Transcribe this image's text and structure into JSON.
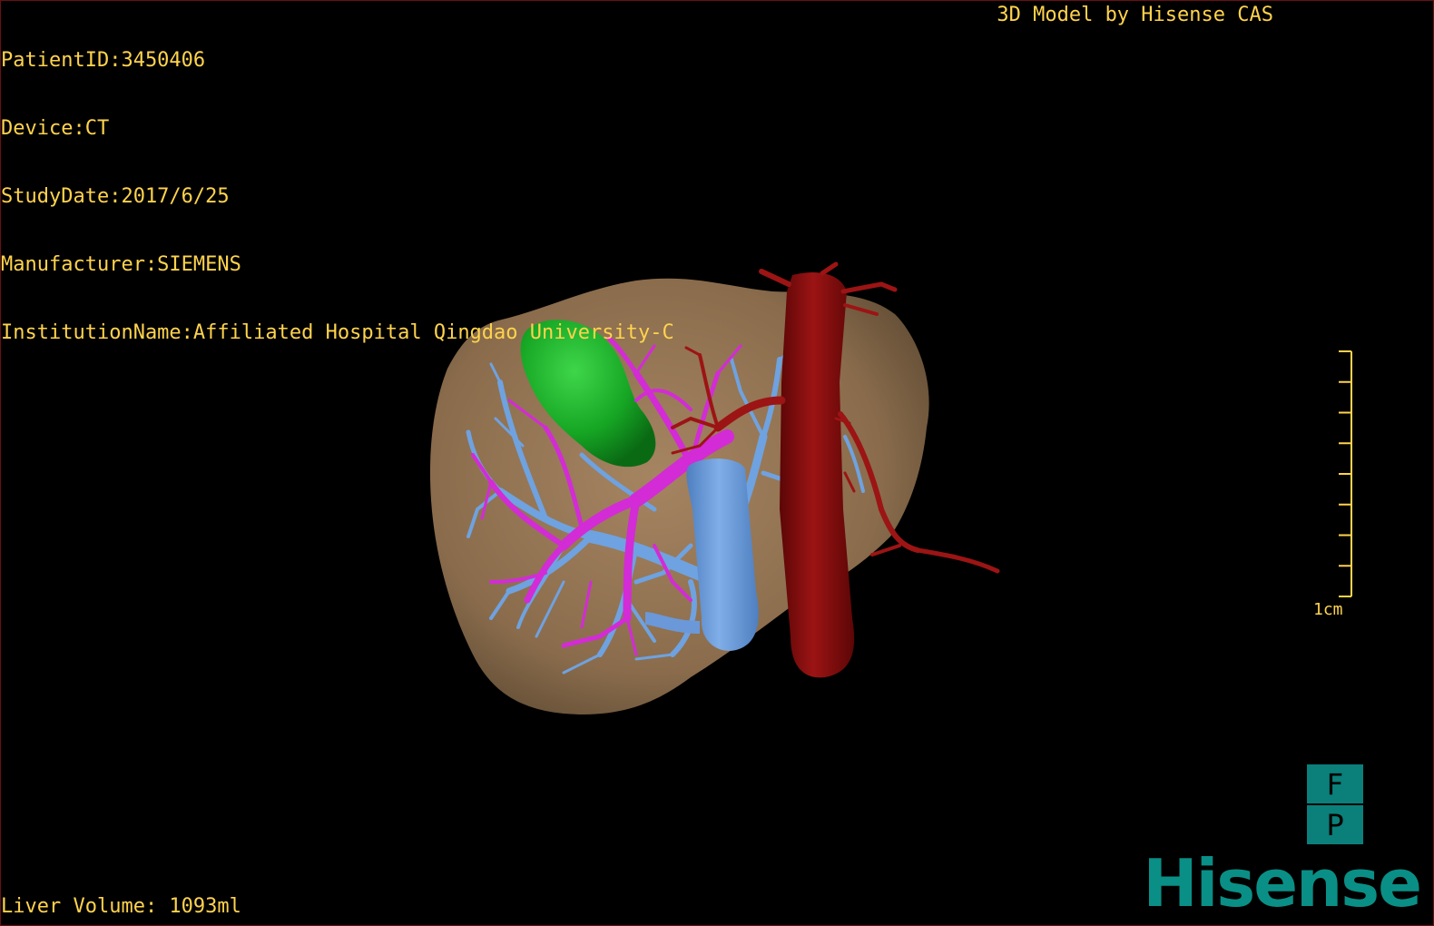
{
  "header": {
    "patient_id": "PatientID:3450406",
    "device": "Device:CT",
    "study_date": "StudyDate:2017/6/25",
    "manufacturer": "Manufacturer:SIEMENS",
    "institution": "InstitutionName:Affiliated Hospital Qingdao University-C"
  },
  "credit": "3D Model by Hisense CAS",
  "footer": {
    "liver_volume": "Liver Volume: 1093ml"
  },
  "scale": {
    "label": "1cm",
    "ticks": 9
  },
  "orientation": {
    "top": "F",
    "bottom": "P"
  },
  "brand": {
    "name": "Hisense",
    "color": "#0a8f86"
  },
  "colors": {
    "overlay_text": "#ffd34d",
    "liver": "#8f7150",
    "tumor": "#18b22a",
    "hepatic_veins": "#6fa2e0",
    "portal_vein": "#d32bd6",
    "ivc": "#6b98d8",
    "aorta": "#8a1010",
    "background": "#000000"
  },
  "structures": [
    "liver",
    "tumor",
    "hepatic veins",
    "portal vein",
    "inferior vena cava",
    "aorta"
  ]
}
